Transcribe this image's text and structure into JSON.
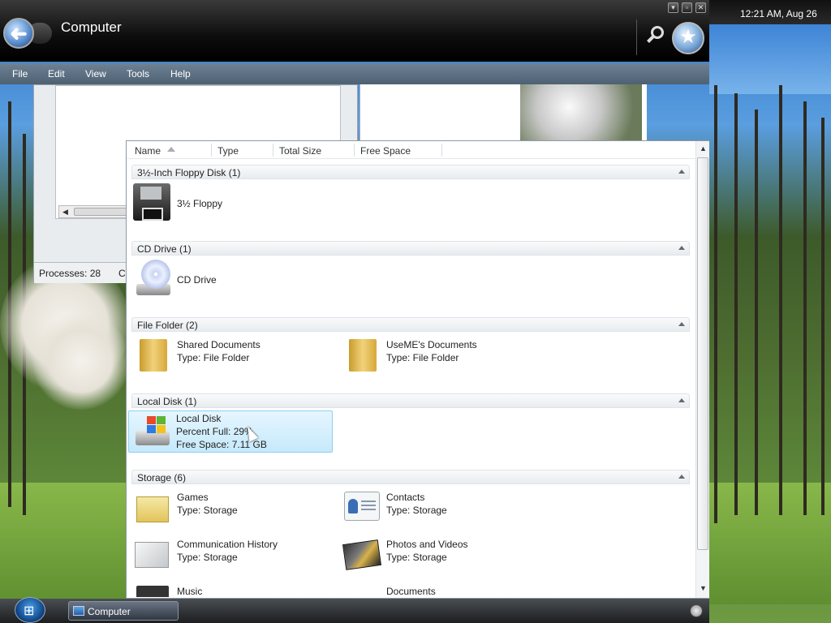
{
  "window": {
    "title": "Computer",
    "controls": {
      "minimize": "▾",
      "restore": "▫",
      "close": "✕"
    },
    "back_glyph": "➜",
    "favorites_glyph": "★"
  },
  "clock": {
    "text": "12:21 AM, Aug 26"
  },
  "menu": [
    "File",
    "Edit",
    "View",
    "Tools",
    "Help"
  ],
  "background_window": {
    "status_processes": "Processes: 28",
    "status_cut": "C"
  },
  "columns": [
    "Name",
    "Type",
    "Total Size",
    "Free Space"
  ],
  "groups": [
    {
      "title": "3½-Inch Floppy Disk (1)"
    },
    {
      "title": "CD Drive (1)"
    },
    {
      "title": "File Folder (2)"
    },
    {
      "title": "Local Disk (1)"
    },
    {
      "title": "Storage (6)"
    }
  ],
  "items": {
    "floppy": {
      "name": "3½ Floppy"
    },
    "cd": {
      "name": "CD Drive"
    },
    "shared_docs": {
      "name": "Shared Documents",
      "type": "Type: File Folder"
    },
    "useme_docs": {
      "name": "UseME's Documents",
      "type": "Type: File Folder"
    },
    "local_disk": {
      "name": "Local Disk",
      "percent": "Percent Full: 29%",
      "free": "Free Space: 7.11 GB"
    },
    "games": {
      "name": "Games",
      "type": "Type: Storage"
    },
    "contacts": {
      "name": "Contacts",
      "type": "Type: Storage"
    },
    "comm_history": {
      "name": "Communication History",
      "type": "Type: Storage"
    },
    "photos": {
      "name": "Photos and Videos",
      "type": "Type: Storage"
    },
    "music": {
      "name": "Music"
    },
    "documents": {
      "name": "Documents"
    }
  },
  "taskbar": {
    "start_glyph": "⊞",
    "task_label": "Computer"
  },
  "colors": {
    "selection": "#c6e9fb",
    "menubar": "#5a6d80",
    "titlebar": "#0c0c0c"
  }
}
